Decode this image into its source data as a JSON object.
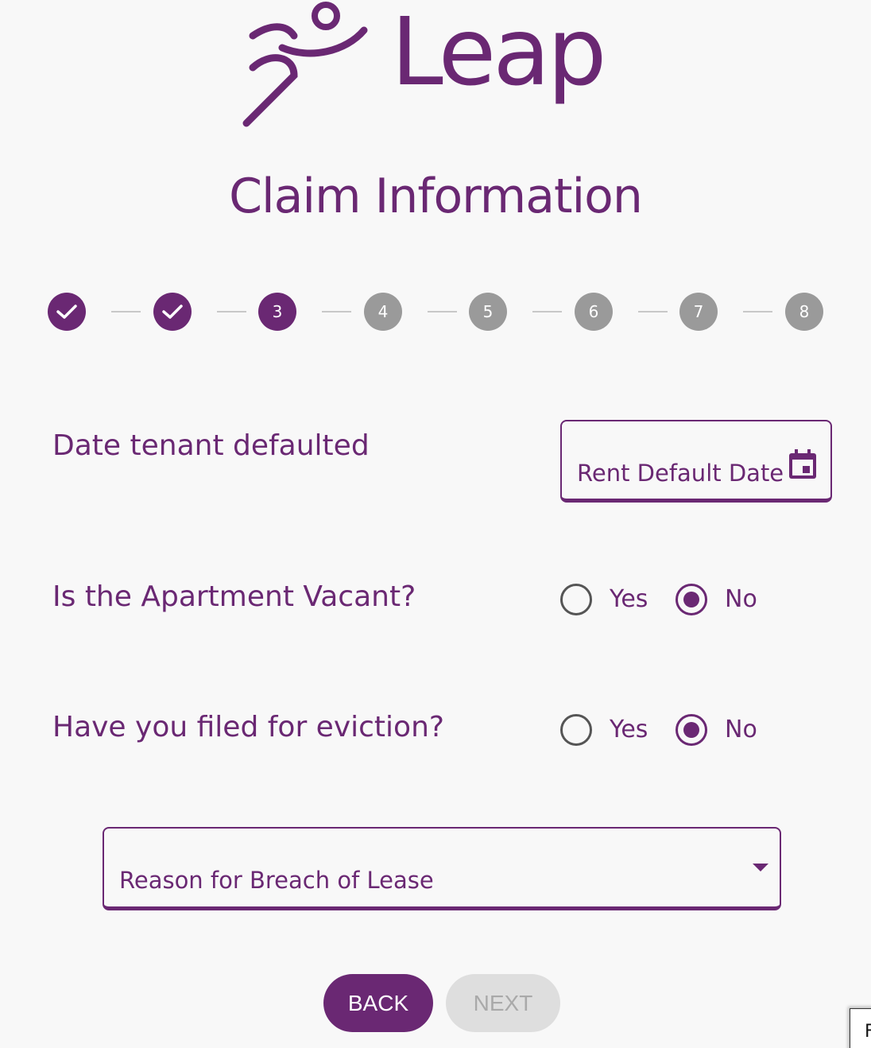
{
  "logo": {
    "text": "Leap"
  },
  "page_title": "Claim Information",
  "stepper": {
    "steps": [
      {
        "label": "",
        "state": "done"
      },
      {
        "label": "",
        "state": "done"
      },
      {
        "label": "3",
        "state": "active"
      },
      {
        "label": "4",
        "state": "pending"
      },
      {
        "label": "5",
        "state": "pending"
      },
      {
        "label": "6",
        "state": "pending"
      },
      {
        "label": "7",
        "state": "pending"
      },
      {
        "label": "8",
        "state": "pending"
      }
    ]
  },
  "date_field": {
    "label": "Date tenant defaulted",
    "placeholder": "Rent Default Date",
    "icon": "calendar-icon"
  },
  "vacant_question": {
    "label": "Is the Apartment Vacant?",
    "options": [
      "Yes",
      "No"
    ],
    "selected": "No"
  },
  "eviction_question": {
    "label": "Have you filed for eviction?",
    "options": [
      "Yes",
      "No"
    ],
    "selected": "No"
  },
  "breach_select": {
    "placeholder": "Reason for Breach of Lease",
    "icon": "chevron-down-icon"
  },
  "buttons": {
    "back": "BACK",
    "next": "NEXT"
  },
  "corner_box": {
    "text": "F"
  },
  "colors": {
    "brand": "#6a2873",
    "pending": "#9a9a9a",
    "disabled_bg": "#dedede"
  }
}
